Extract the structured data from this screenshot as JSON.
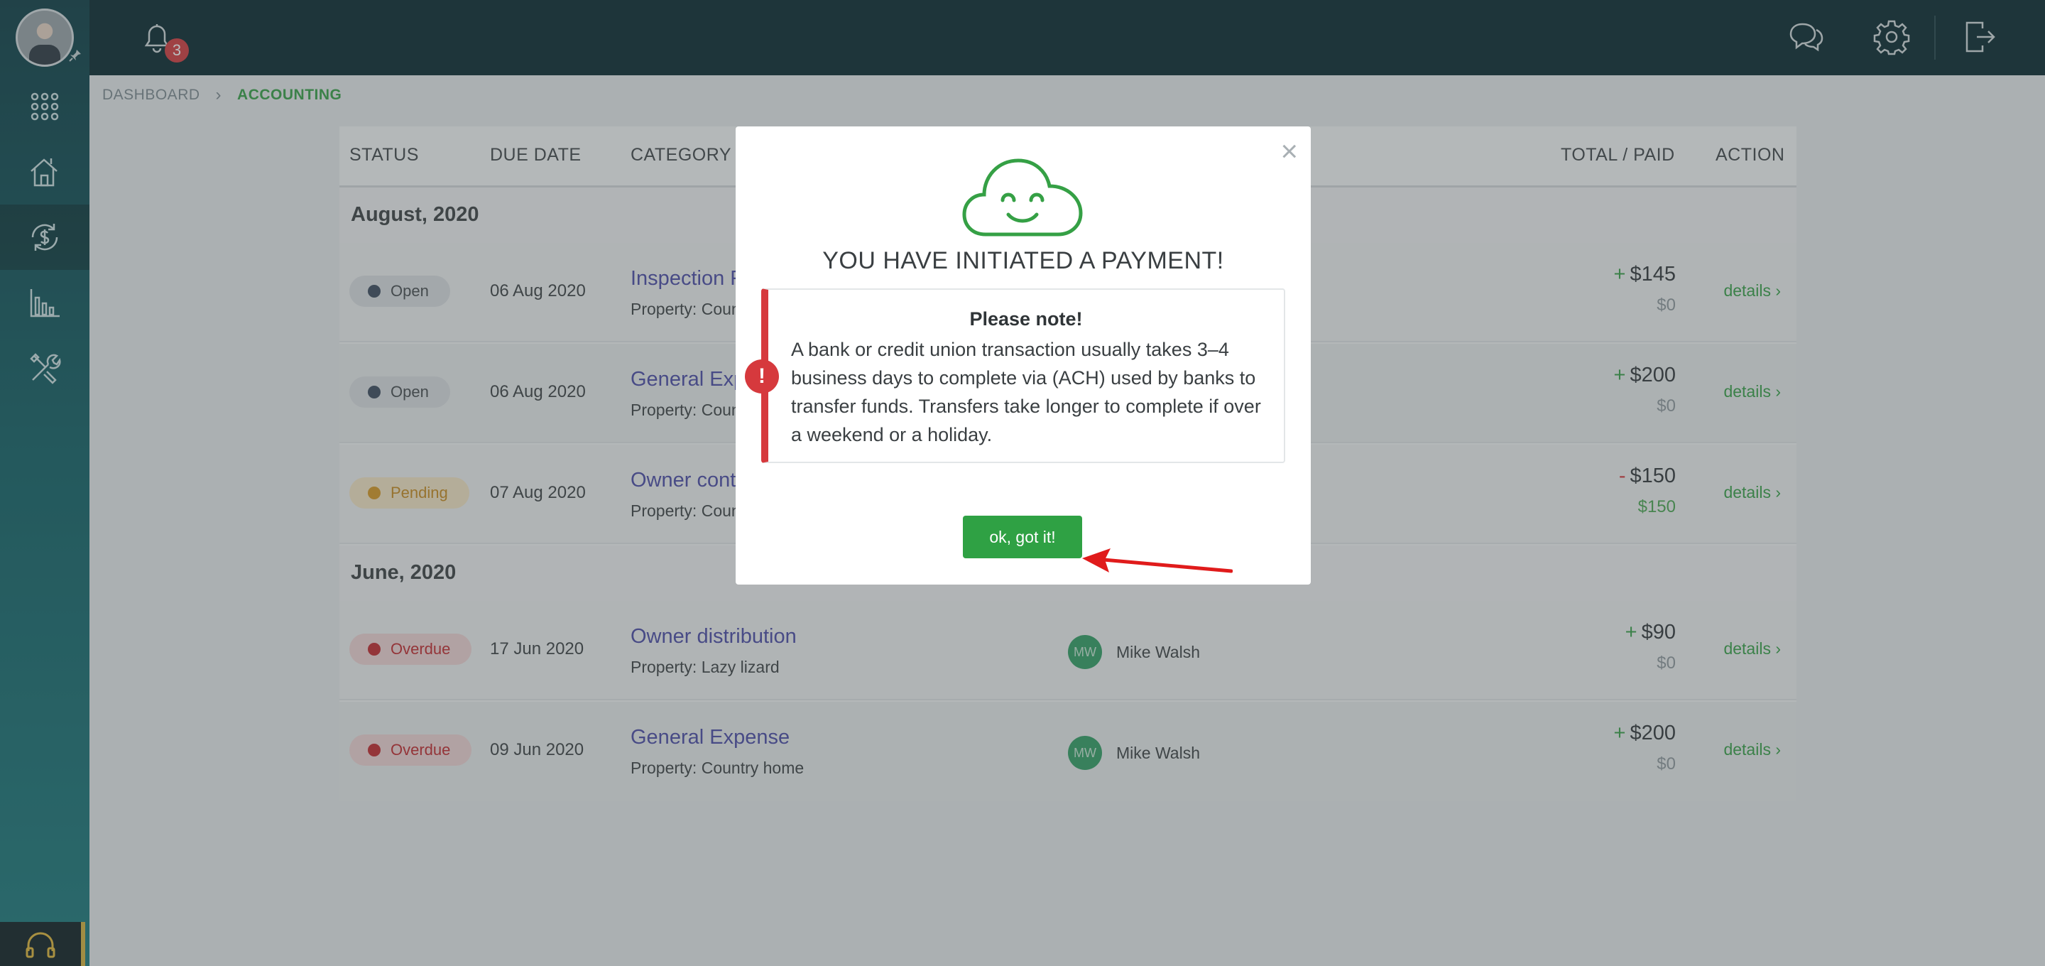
{
  "topbar": {
    "notification_count": "3",
    "icons": [
      "bell-icon",
      "chat-icon",
      "gear-icon",
      "logout-icon"
    ]
  },
  "sidebar": {
    "items": [
      "apps-grid-icon",
      "properties-icon",
      "accounting-icon",
      "reports-icon",
      "tools-icon"
    ],
    "active": "accounting-icon"
  },
  "breadcrumb": {
    "home": "DASHBOARD",
    "current": "ACCOUNTING"
  },
  "table": {
    "headers": {
      "status": "STATUS",
      "due_date": "DUE DATE",
      "category": "CATEGORY /",
      "total_paid": "TOTAL / PAID",
      "action": "ACTION"
    },
    "groups": [
      {
        "label": "August, 2020",
        "rows": [
          {
            "status": "Open",
            "due": "06 Aug 2020",
            "category": "Inspection F",
            "property": "Property: Coun",
            "sign": "+",
            "total": "$145",
            "paid": "$0",
            "action": "details ›"
          },
          {
            "status": "Open",
            "due": "06 Aug 2020",
            "category": "General Exp",
            "property": "Property: Coun",
            "sign": "+",
            "total": "$200",
            "paid": "$0",
            "action": "details ›"
          },
          {
            "status": "Pending",
            "due": "07 Aug 2020",
            "category": "Owner cont",
            "property": "Property: Coun",
            "sign": "-",
            "total": "$150",
            "paid": "$150",
            "action": "details ›"
          }
        ]
      },
      {
        "label": "June, 2020",
        "rows": [
          {
            "status": "Overdue",
            "due": "17 Jun 2020",
            "category": "Owner distribution",
            "property": "Property: Lazy lizard",
            "initials": "MW",
            "person": "Mike Walsh",
            "sign": "+",
            "total": "$90",
            "paid": "$0",
            "action": "details ›"
          },
          {
            "status": "Overdue",
            "due": "09 Jun 2020",
            "category": "General Expense",
            "property": "Property: Country home",
            "initials": "MW",
            "person": "Mike Walsh",
            "sign": "+",
            "total": "$200",
            "paid": "$0",
            "action": "details ›"
          }
        ]
      }
    ]
  },
  "modal": {
    "close": "×",
    "title": "YOU HAVE INITIATED A PAYMENT!",
    "note_badge": "!",
    "note_title": "Please note!",
    "note_text": "A bank or credit union transaction usually takes 3–4 business days to complete via (ACH) used by banks to transfer funds. Transfers take longer to complete if over a weekend or a holiday.",
    "button": "ok, got it!"
  },
  "colors": {
    "accent_green": "#2fa144",
    "alert_red": "#d6393d",
    "link_purple": "#4a4aa6",
    "topbar": "#06262d"
  }
}
